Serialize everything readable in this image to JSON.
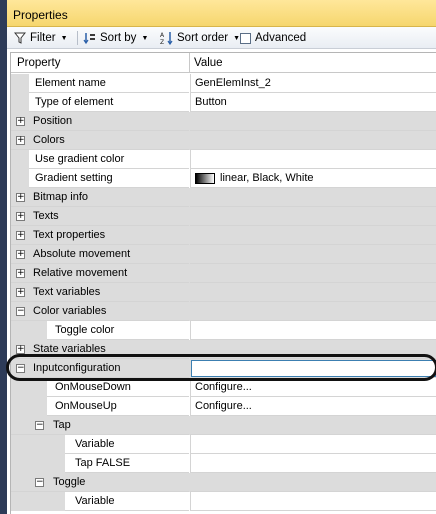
{
  "panel": {
    "title": "Properties"
  },
  "toolbar": {
    "filter_label": "Filter",
    "sortby_label": "Sort by",
    "sortorder_label": "Sort order",
    "advanced_label": "Advanced"
  },
  "grid": {
    "col_property": "Property",
    "col_value": "Value",
    "rows": [
      {
        "label": "Element name",
        "value": "GenElemInst_2"
      },
      {
        "label": "Type of element",
        "value": "Button"
      },
      {
        "label": "Position",
        "expander": "+"
      },
      {
        "label": "Colors",
        "expander": "+"
      },
      {
        "label": "Use gradient color",
        "value": ""
      },
      {
        "label": "Gradient setting",
        "value": "linear, Black, White"
      },
      {
        "label": "Bitmap info",
        "expander": "+"
      },
      {
        "label": "Texts",
        "expander": "+"
      },
      {
        "label": "Text properties",
        "expander": "+"
      },
      {
        "label": "Absolute movement",
        "expander": "+"
      },
      {
        "label": "Relative movement",
        "expander": "+"
      },
      {
        "label": "Text variables",
        "expander": "+"
      },
      {
        "label": "Color variables",
        "expander": "−"
      },
      {
        "label": "Toggle color",
        "value": ""
      },
      {
        "label": "State variables",
        "expander": "+"
      },
      {
        "label": "Inputconfiguration",
        "expander": "−",
        "value": ""
      },
      {
        "label": "OnMouseDown",
        "value": "Configure..."
      },
      {
        "label": "OnMouseUp",
        "value": "Configure..."
      },
      {
        "label": "Tap",
        "expander": "−"
      },
      {
        "label": "Variable",
        "value": ""
      },
      {
        "label": "Tap FALSE",
        "value": ""
      },
      {
        "label": "Toggle",
        "expander": "−"
      },
      {
        "label": "Variable",
        "value": ""
      }
    ]
  },
  "colors": {
    "title_bar": "#f6d66e",
    "group_row": "#dcdcdc",
    "frame": "#2d3b58"
  }
}
